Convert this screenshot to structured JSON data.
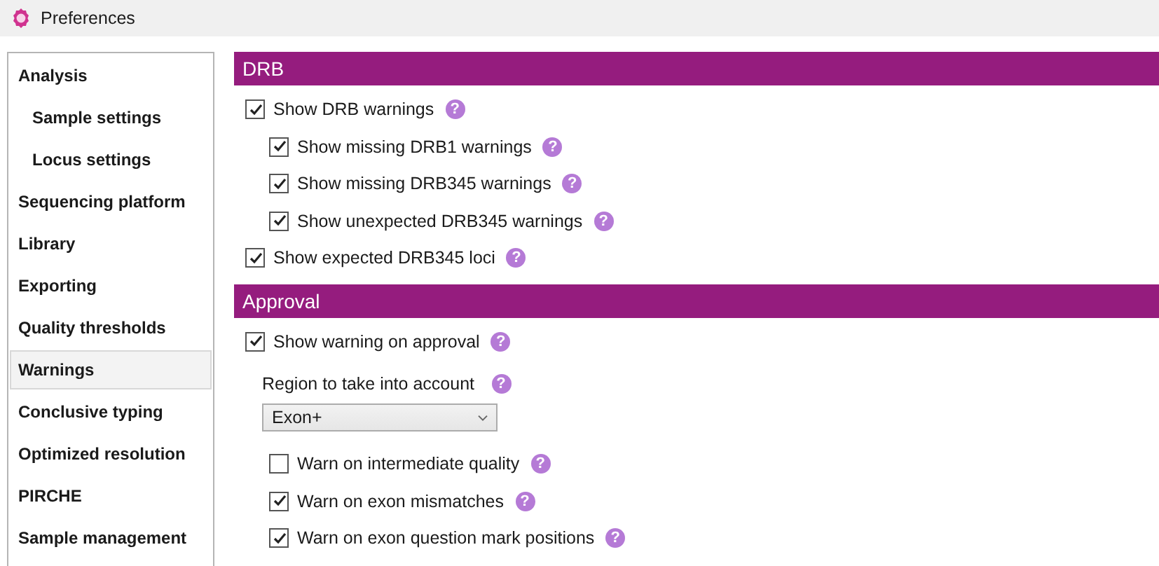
{
  "window": {
    "title": "Preferences"
  },
  "sidebar": {
    "items": [
      {
        "label": "Analysis",
        "selected": false,
        "children": [
          {
            "label": "Sample settings",
            "selected": false
          },
          {
            "label": "Locus settings",
            "selected": false
          }
        ]
      },
      {
        "label": "Sequencing platform",
        "selected": false
      },
      {
        "label": "Library",
        "selected": false
      },
      {
        "label": "Exporting",
        "selected": false
      },
      {
        "label": "Quality thresholds",
        "selected": false
      },
      {
        "label": "Warnings",
        "selected": true
      },
      {
        "label": "Conclusive typing",
        "selected": false
      },
      {
        "label": "Optimized resolution",
        "selected": false
      },
      {
        "label": "PIRCHE",
        "selected": false
      },
      {
        "label": "Sample management",
        "selected": false
      }
    ]
  },
  "sections": [
    {
      "title": "DRB",
      "items": [
        {
          "kind": "checkbox",
          "label": "Show DRB warnings",
          "checked": true,
          "help": "?",
          "children": [
            {
              "kind": "checkbox",
              "label": "Show missing DRB1 warnings",
              "checked": true,
              "help": "?"
            },
            {
              "kind": "checkbox",
              "label": "Show missing DRB345 warnings",
              "checked": true,
              "help": "?"
            },
            {
              "kind": "checkbox",
              "label": "Show unexpected DRB345 warnings",
              "checked": true,
              "help": "?"
            }
          ]
        },
        {
          "kind": "checkbox",
          "label": "Show expected DRB345 loci",
          "checked": true,
          "help": "?"
        }
      ]
    },
    {
      "title": "Approval",
      "items": [
        {
          "kind": "checkbox",
          "label": "Show warning on approval",
          "checked": true,
          "help": "?",
          "children": [
            {
              "kind": "select",
              "label": "Region to take into account",
              "value": "Exon+",
              "help": "?"
            },
            {
              "kind": "checkbox",
              "label": "Warn on intermediate quality",
              "checked": false,
              "help": "?"
            },
            {
              "kind": "checkbox",
              "label": "Warn on exon mismatches",
              "checked": true,
              "help": "?"
            },
            {
              "kind": "checkbox",
              "label": "Warn on exon question mark positions",
              "checked": true,
              "help": "?"
            }
          ]
        }
      ]
    }
  ]
}
